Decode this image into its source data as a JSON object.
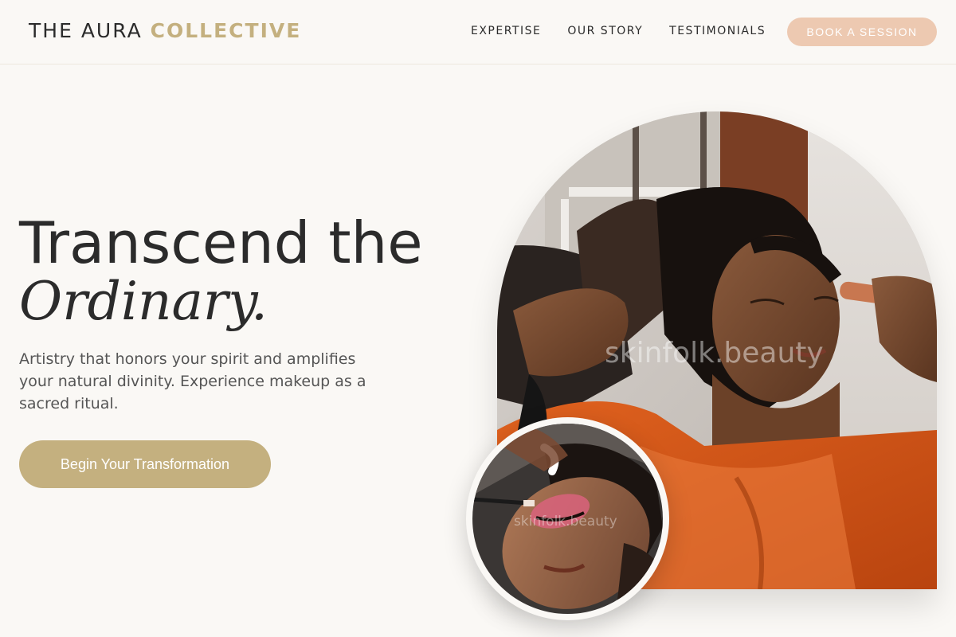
{
  "header": {
    "logo_part1": "THE AURA",
    "logo_part2": "COLLECTIVE",
    "nav": [
      {
        "label": "EXPERTISE"
      },
      {
        "label": "OUR STORY"
      },
      {
        "label": "TESTIMONIALS"
      }
    ],
    "book_label": "BOOK A SESSION"
  },
  "hero": {
    "title_line1": "Transcend the",
    "title_line2": "Ordinary.",
    "subtitle": "Artistry that honors your spirit and amplifies your natural divinity. Experience makeup as a sacred ritual.",
    "cta_label": "Begin Your Transformation"
  },
  "images": {
    "main_watermark": "skinfolk.beauty",
    "inset_watermark": "skinfolk.beauty"
  },
  "colors": {
    "background": "#faf8f5",
    "gold_accent": "#c4b07f",
    "peach_button": "#edc9b1",
    "text": "#2b2b2b"
  }
}
